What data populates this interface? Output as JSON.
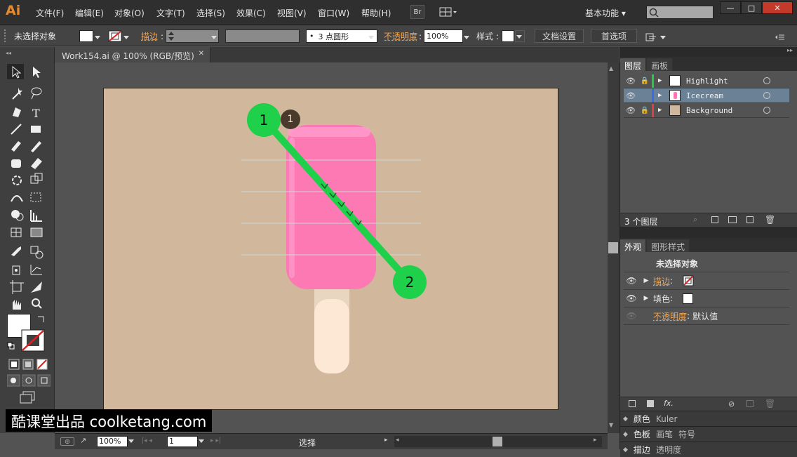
{
  "app": {
    "logo": "Ai"
  },
  "menu": [
    "文件(F)",
    "编辑(E)",
    "对象(O)",
    "文字(T)",
    "选择(S)",
    "效果(C)",
    "视图(V)",
    "窗口(W)",
    "帮助(H)"
  ],
  "menubar": {
    "bridge_label": "Br",
    "workspace": "基本功能",
    "workspace_arrow": "▾"
  },
  "window_controls": {
    "minimize": "—",
    "maximize": "□",
    "close": "✕"
  },
  "control": {
    "selection_status": "未选择对象",
    "stroke_label": "描边",
    "brush_label": "3 点圆形",
    "opacity_label": "不透明度",
    "opacity_value": "100%",
    "style_label": "样式",
    "doc_setup_button": "文档设置",
    "prefs_button": "首选项"
  },
  "document": {
    "tab_title": "Work154.ai @ 100% (RGB/预览)",
    "close_glyph": "✕"
  },
  "artwork": {
    "step_one_label": "1",
    "step_one_badge": "1",
    "step_two_label": "2",
    "background_color": "#d1b79c",
    "icecream_color": "#fd79b4",
    "stick_color": "#fde8d6",
    "guide_color": "#1fd04a"
  },
  "layers_panel": {
    "tabs": [
      "图层",
      "画板"
    ],
    "layers": [
      {
        "name": "Highlight",
        "color": "#22cc44",
        "thumb": "#ffffff"
      },
      {
        "name": "Icecream",
        "color": "#3a6cf0",
        "thumb": "#fd79b4"
      },
      {
        "name": "Background",
        "color": "#e04040",
        "thumb": "#d1b79c"
      }
    ],
    "footer_count": "3 个图层"
  },
  "appearance_panel": {
    "tabs": [
      "外观",
      "图形样式"
    ],
    "header": "未选择对象",
    "stroke_label": "描边",
    "fill_label": "填色",
    "opacity_label": "不透明度",
    "opacity_value": "默认值",
    "fx_label": "fx."
  },
  "collapsed_panels": {
    "row1": [
      "颜色",
      "Kuler"
    ],
    "row2": [
      "色板",
      "画笔",
      "符号"
    ],
    "row3": [
      "描边",
      "透明度"
    ]
  },
  "status": {
    "zoom": "100%",
    "artboard_num": "1",
    "tool_name": "选择"
  },
  "watermark": "酷课堂出品 coolketang.com"
}
